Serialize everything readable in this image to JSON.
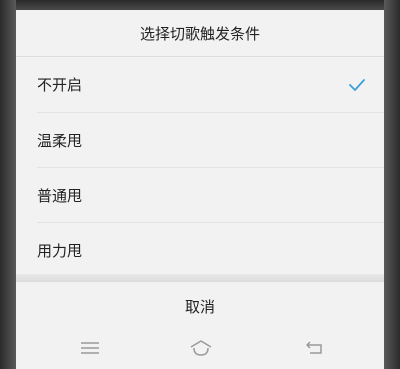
{
  "dialog": {
    "title": "选择切歌触发条件",
    "options": [
      {
        "label": "不开启",
        "selected": true
      },
      {
        "label": "温柔甩",
        "selected": false
      },
      {
        "label": "普通甩",
        "selected": false
      },
      {
        "label": "用力甩",
        "selected": false
      }
    ],
    "cancel_label": "取消"
  },
  "navbar": {
    "buttons": [
      "menu-icon",
      "home-icon",
      "back-icon"
    ]
  },
  "colors": {
    "accent": "#3aa1d8",
    "sheet_background": "#f2f2f2",
    "frame": "#3a3a3a"
  }
}
